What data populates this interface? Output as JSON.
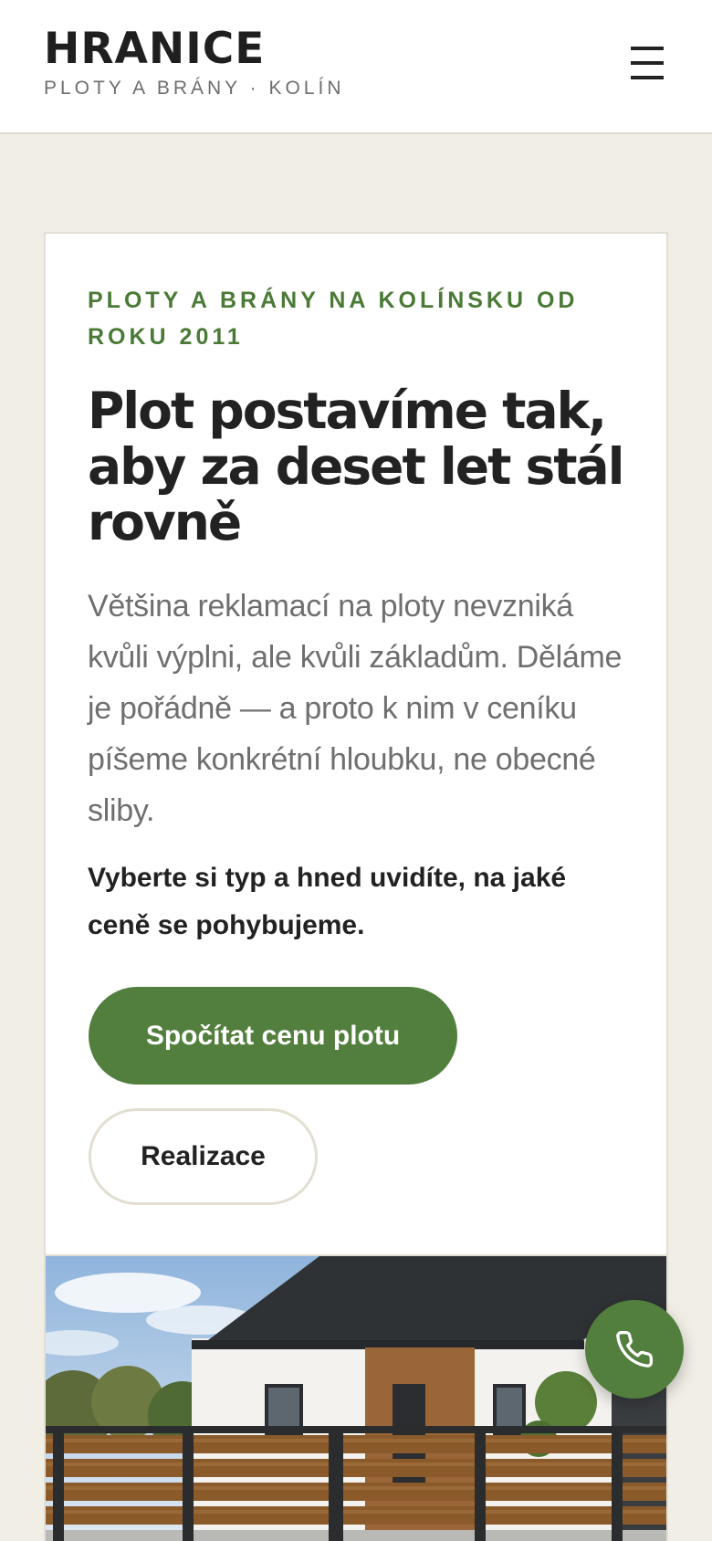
{
  "header": {
    "logo_title": "HRANICE",
    "logo_subtitle": "PLOTY A BRÁNY · KOLÍN",
    "menu_icon": "hamburger-menu-icon"
  },
  "hero": {
    "eyebrow": "PLOTY A BRÁNY NA KOLÍNSKU OD ROKU 2011",
    "title": "Plot postavíme tak, aby za deset let stál rovně",
    "lead": "Většina reklamací na ploty nevzniká kvůli výplni, ale kvůli základům. Děláme je pořádně — a proto k nim v ceníku píšeme konkrétní hloubku, ne obecné sliby.",
    "note": "Vyberte si typ a hned uvidíte, na jaké ceně se pohybujeme.",
    "primary_button": "Spočítat cenu plotu",
    "secondary_button": "Realizace"
  },
  "photo": {
    "subject": "house-with-wooden-fence-image"
  },
  "call_button": {
    "icon": "phone-icon"
  },
  "colors": {
    "accent_green": "#527f3d",
    "eyebrow_green": "#4a7a36",
    "page_background": "#f1eee6",
    "text_dark": "#222222",
    "text_muted": "#6f6f6f"
  }
}
